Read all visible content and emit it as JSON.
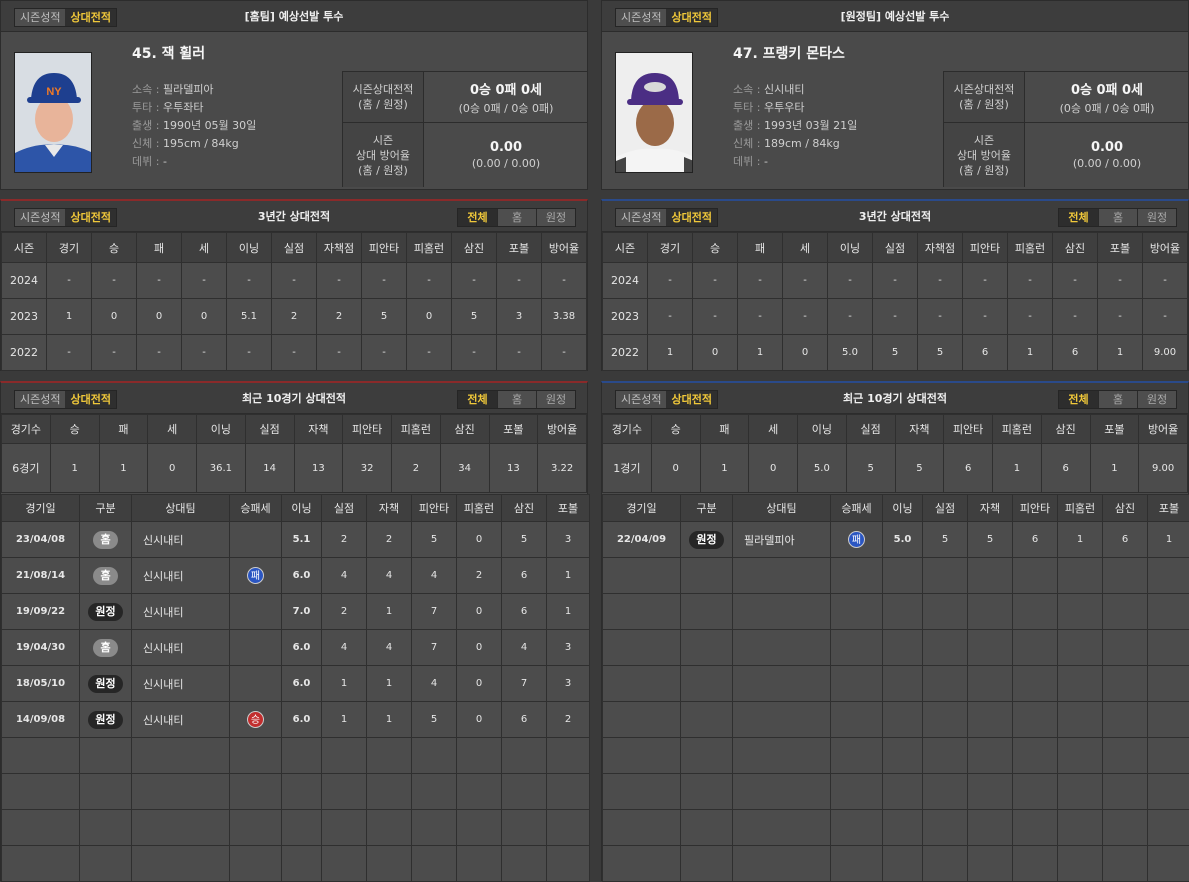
{
  "common": {
    "tabs": [
      "시즌성적",
      "상대전적"
    ],
    "filters": [
      "전체",
      "홈",
      "원정"
    ]
  },
  "home": {
    "profile_title": "[홈팀] 예상선발 투수",
    "name": "45. 잭 휠러",
    "info": [
      {
        "k": "소속",
        "v": "필라델피아"
      },
      {
        "k": "투타",
        "v": "우투좌타"
      },
      {
        "k": "출생",
        "v": "1990년 05월 30일"
      },
      {
        "k": "신체",
        "v": "195cm / 84kg"
      },
      {
        "k": "데뷔",
        "v": "-"
      }
    ],
    "summary": [
      {
        "label": "시즌상대전적\n(홈 / 원정)",
        "big": "0승 0패 0세",
        "small": "(0승 0패 / 0승 0패)"
      },
      {
        "label": "시즌\n상대 방어율\n(홈 / 원정)",
        "big": "0.00",
        "small": "(0.00 / 0.00)"
      }
    ],
    "three_year": {
      "title": "3년간 상대전적",
      "headers": [
        "시즌",
        "경기",
        "승",
        "패",
        "세",
        "이닝",
        "실점",
        "자책점",
        "피안타",
        "피홈런",
        "삼진",
        "포볼",
        "방어율"
      ],
      "rows": [
        [
          "2024",
          "-",
          "-",
          "-",
          "-",
          "-",
          "-",
          "-",
          "-",
          "-",
          "-",
          "-",
          "-"
        ],
        [
          "2023",
          "1",
          "0",
          "0",
          "0",
          "5.1",
          "2",
          "2",
          "5",
          "0",
          "5",
          "3",
          "3.38"
        ],
        [
          "2022",
          "-",
          "-",
          "-",
          "-",
          "-",
          "-",
          "-",
          "-",
          "-",
          "-",
          "-",
          "-"
        ]
      ]
    },
    "recent": {
      "title": "최근 10경기 상대전적",
      "sum_headers": [
        "경기수",
        "승",
        "패",
        "세",
        "이닝",
        "실점",
        "자책",
        "피안타",
        "피홈런",
        "삼진",
        "포볼",
        "방어율"
      ],
      "sum_row": [
        "6경기",
        "1",
        "1",
        "0",
        "36.1",
        "14",
        "13",
        "32",
        "2",
        "34",
        "13",
        "3.22"
      ],
      "game_headers": [
        "경기일",
        "구분",
        "상대팀",
        "승패세",
        "이닝",
        "실점",
        "자책",
        "피안타",
        "피홈런",
        "삼진",
        "포볼"
      ],
      "games": [
        {
          "date": "23/04/08",
          "loc": "홈",
          "team": "신시내티",
          "res": "",
          "ip": "5.1",
          "r": "2",
          "er": "2",
          "h": "5",
          "hr": "0",
          "so": "5",
          "bb": "3"
        },
        {
          "date": "21/08/14",
          "loc": "홈",
          "team": "신시내티",
          "res": "패",
          "ip": "6.0",
          "r": "4",
          "er": "4",
          "h": "4",
          "hr": "2",
          "so": "6",
          "bb": "1"
        },
        {
          "date": "19/09/22",
          "loc": "원정",
          "team": "신시내티",
          "res": "",
          "ip": "7.0",
          "r": "2",
          "er": "1",
          "h": "7",
          "hr": "0",
          "so": "6",
          "bb": "1"
        },
        {
          "date": "19/04/30",
          "loc": "홈",
          "team": "신시내티",
          "res": "",
          "ip": "6.0",
          "r": "4",
          "er": "4",
          "h": "7",
          "hr": "0",
          "so": "4",
          "bb": "3"
        },
        {
          "date": "18/05/10",
          "loc": "원정",
          "team": "신시내티",
          "res": "",
          "ip": "6.0",
          "r": "1",
          "er": "1",
          "h": "4",
          "hr": "0",
          "so": "7",
          "bb": "3"
        },
        {
          "date": "14/09/08",
          "loc": "원정",
          "team": "신시내티",
          "res": "승",
          "ip": "6.0",
          "r": "1",
          "er": "1",
          "h": "5",
          "hr": "0",
          "so": "6",
          "bb": "2"
        }
      ]
    }
  },
  "away": {
    "profile_title": "[원정팀] 예상선발 투수",
    "name": "47. 프랭키 몬타스",
    "info": [
      {
        "k": "소속",
        "v": "신시내티"
      },
      {
        "k": "투타",
        "v": "우투우타"
      },
      {
        "k": "출생",
        "v": "1993년 03월 21일"
      },
      {
        "k": "신체",
        "v": "189cm / 84kg"
      },
      {
        "k": "데뷔",
        "v": "-"
      }
    ],
    "summary": [
      {
        "label": "시즌상대전적\n(홈 / 원정)",
        "big": "0승 0패 0세",
        "small": "(0승 0패 / 0승 0패)"
      },
      {
        "label": "시즌\n상대 방어율\n(홈 / 원정)",
        "big": "0.00",
        "small": "(0.00 / 0.00)"
      }
    ],
    "three_year": {
      "title": "3년간 상대전적",
      "headers": [
        "시즌",
        "경기",
        "승",
        "패",
        "세",
        "이닝",
        "실점",
        "자책점",
        "피안타",
        "피홈런",
        "삼진",
        "포볼",
        "방어율"
      ],
      "rows": [
        [
          "2024",
          "-",
          "-",
          "-",
          "-",
          "-",
          "-",
          "-",
          "-",
          "-",
          "-",
          "-",
          "-"
        ],
        [
          "2023",
          "-",
          "-",
          "-",
          "-",
          "-",
          "-",
          "-",
          "-",
          "-",
          "-",
          "-",
          "-"
        ],
        [
          "2022",
          "1",
          "0",
          "1",
          "0",
          "5.0",
          "5",
          "5",
          "6",
          "1",
          "6",
          "1",
          "9.00"
        ]
      ]
    },
    "recent": {
      "title": "최근 10경기 상대전적",
      "sum_headers": [
        "경기수",
        "승",
        "패",
        "세",
        "이닝",
        "실점",
        "자책",
        "피안타",
        "피홈런",
        "삼진",
        "포볼",
        "방어율"
      ],
      "sum_row": [
        "1경기",
        "0",
        "1",
        "0",
        "5.0",
        "5",
        "5",
        "6",
        "1",
        "6",
        "1",
        "9.00"
      ],
      "game_headers": [
        "경기일",
        "구분",
        "상대팀",
        "승패세",
        "이닝",
        "실점",
        "자책",
        "피안타",
        "피홈런",
        "삼진",
        "포볼"
      ],
      "games": [
        {
          "date": "22/04/09",
          "loc": "원정",
          "team": "필라델피아",
          "res": "패",
          "ip": "5.0",
          "r": "5",
          "er": "5",
          "h": "6",
          "hr": "1",
          "so": "6",
          "bb": "1"
        }
      ]
    }
  },
  "colors": {
    "accent": "#f0c83a",
    "loss": "#2b56c2",
    "win": "#c22e2e",
    "home_bar": "#8a2a2a",
    "away_bar": "#2a4a8a"
  }
}
